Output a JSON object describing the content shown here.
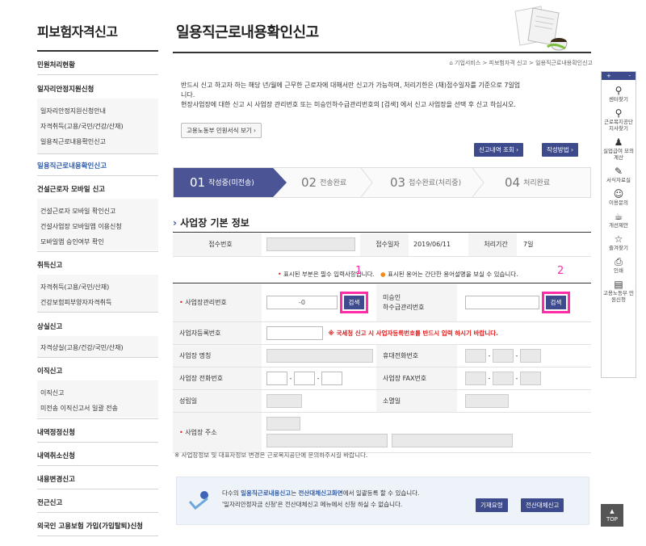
{
  "nav": {
    "title": "피보험자격신고",
    "items": [
      {
        "label": "민원처리현황"
      },
      {
        "label": "일자리안정지원신청",
        "subs": [
          "일자리안정지원신청안내",
          "자격취득(고용/국민/건강/산재)",
          "일용직근로내용확인신고"
        ]
      },
      {
        "label": "일용직근로내용확인신고"
      },
      {
        "label": "건설근로자 모바일 신고",
        "subs": [
          "건설근로자 모바일 확인신고",
          "건설사업장 모바일앱 이용신청",
          "모바일앱 승인여부 확인"
        ]
      },
      {
        "label": "취득신고",
        "subs": [
          "자격취득(고용/국민/산재)",
          "건강보험피부양자자격취득"
        ]
      },
      {
        "label": "상실신고",
        "subs": [
          "자격상실(고용/건강/국민/산재)"
        ]
      },
      {
        "label": "이직신고",
        "subs": [
          "이직신고",
          "미전송 이직신고서 일괄 전송"
        ]
      },
      {
        "label": "내역정정신청"
      },
      {
        "label": "내역취소신청"
      },
      {
        "label": "내용변경신고"
      },
      {
        "label": "전근신고"
      },
      {
        "label": "외국인 고용보험 가입(가입탈퇴)신청"
      }
    ]
  },
  "main": {
    "title": "일용직근로내용확인신고",
    "breadcrumb": "기업서비스 > 피보험자격 신고 > 일용직근로내용확인신고",
    "desc1": "반드시 신고 하고자 하는 해당 년/월에 근무한 근로자에 대해서만 신고가 가능하며, 처리기한은 (채)접수일자를 기준으로 7일업",
    "desc1b": "니다.",
    "desc2": "현장사업장에 대한 신고 시 사업장 관리번호 또는 미승인하수급관리번호의 [검색] 에서 신고 사업장을 선택 후 신고 하십시오.",
    "form_btn": "고용노동부 민원서식 보기 ›",
    "history_btn": "신고내역 조회 ›",
    "howto_btn": "작성방법 ›",
    "steps": [
      {
        "num": "01",
        "label": "작성중(미전송)"
      },
      {
        "num": "02",
        "label": "전송완료"
      },
      {
        "num": "03",
        "label": "접수완료(처리중)"
      },
      {
        "num": "04",
        "label": "처리완료"
      }
    ],
    "section_title": "사업장 기본 정보",
    "info": {
      "receipt_no_label": "접수번호",
      "receipt_date_label": "접수일자",
      "receipt_date": "2019/06/11",
      "period_label": "처리기간",
      "period": "7일"
    },
    "required_note": "표시된 부분은 필수 입력사항입니다.",
    "help_note": "표시된 용어는 간단한 용어설명을 보실 수 있습니다.",
    "fields": {
      "mgmt_no": "사업장관리번호",
      "mgmt_value": "-0",
      "search": "검색",
      "unapproved": "미승인",
      "sub_mgmt": "하수급관리번호",
      "biz_reg": "사업자등록번호",
      "biz_warn": "※ 국세청 신고 시 사업자등록번호를 반드시 입력 하시기 바랍니다.",
      "biz_name": "사업장 명칭",
      "mobile": "휴대전화번호",
      "phone": "사업장 전화번호",
      "fax": "사업장 FAX번호",
      "est_date": "성립일",
      "close_date": "소멸일",
      "address": "사업장 주소"
    },
    "marker1": "1",
    "marker2": "2",
    "footnote": "※ 사업장정보 및 대표자정보 변경은 근로복지공단에 문의하주시길 바랍니다.",
    "notice1_a": "다수의 ",
    "notice1_b": "일용직근로내용신고",
    "notice1_c": "는 ",
    "notice1_d": "전산대체신고화면",
    "notice1_e": "에서 일괄등록 할 수 있습니다.",
    "notice2": "'일자리안정자금 신청'은 전산대체신고 메뉴에서 신청 하실 수 없습니다.",
    "guide_btn": "기재요령",
    "bulk_btn": "전산대체신고"
  },
  "rail": {
    "plus": "+",
    "minus": "-",
    "items": [
      {
        "icon": "pin-icon",
        "glyph": "⚲",
        "label": "센터찾기"
      },
      {
        "icon": "pin-icon",
        "glyph": "⚲",
        "label": "근로복지공단 지사찾기"
      },
      {
        "icon": "person-icon",
        "glyph": "♟",
        "label": "실업급여 모의계산"
      },
      {
        "icon": "edit-icon",
        "glyph": "✎",
        "label": "서식자료실"
      },
      {
        "icon": "chat-icon",
        "glyph": "☺",
        "label": "이용문의"
      },
      {
        "icon": "cup-icon",
        "glyph": "☕",
        "label": "개선제안"
      },
      {
        "icon": "star-icon",
        "glyph": "☆",
        "label": "즐겨찾기"
      },
      {
        "icon": "print-icon",
        "glyph": "⎙",
        "label": "인쇄"
      },
      {
        "icon": "doc-icon",
        "glyph": "▤",
        "label": "고용노동부 민원신청"
      }
    ],
    "top": "TOP"
  }
}
